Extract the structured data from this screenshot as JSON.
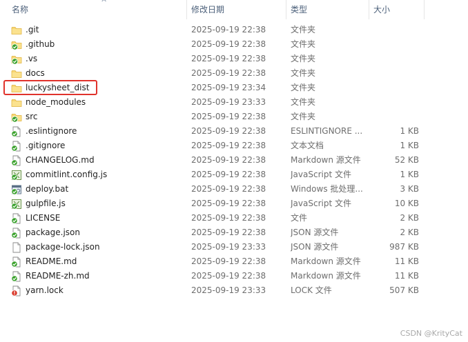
{
  "columns": {
    "name": "名称",
    "date": "修改日期",
    "type": "类型",
    "size": "大小"
  },
  "sort_indicator": "^",
  "files": [
    {
      "name": ".git",
      "date": "2025-09-19 22:38",
      "type": "文件夹",
      "size": "",
      "icon": "folder-icon"
    },
    {
      "name": ".github",
      "date": "2025-09-19 22:38",
      "type": "文件夹",
      "size": "",
      "icon": "folder-synced-icon"
    },
    {
      "name": ".vs",
      "date": "2025-09-19 22:38",
      "type": "文件夹",
      "size": "",
      "icon": "folder-synced-icon"
    },
    {
      "name": "docs",
      "date": "2025-09-19 22:38",
      "type": "文件夹",
      "size": "",
      "icon": "folder-icon"
    },
    {
      "name": "luckysheet_dist",
      "date": "2025-09-19 23:34",
      "type": "文件夹",
      "size": "",
      "icon": "folder-icon"
    },
    {
      "name": "node_modules",
      "date": "2025-09-19 23:33",
      "type": "文件夹",
      "size": "",
      "icon": "folder-icon"
    },
    {
      "name": "src",
      "date": "2025-09-19 22:38",
      "type": "文件夹",
      "size": "",
      "icon": "folder-synced-icon"
    },
    {
      "name": ".eslintignore",
      "date": "2025-09-19 22:38",
      "type": "ESLINTIGNORE ...",
      "size": "1 KB",
      "icon": "file-synced-icon"
    },
    {
      "name": ".gitignore",
      "date": "2025-09-19 22:38",
      "type": "文本文档",
      "size": "1 KB",
      "icon": "file-synced-icon"
    },
    {
      "name": "CHANGELOG.md",
      "date": "2025-09-19 22:38",
      "type": "Markdown 源文件",
      "size": "52 KB",
      "icon": "file-synced-icon"
    },
    {
      "name": "commitlint.config.js",
      "date": "2025-09-19 22:38",
      "type": "JavaScript 文件",
      "size": "1 KB",
      "icon": "script-synced-icon"
    },
    {
      "name": "deploy.bat",
      "date": "2025-09-19 22:38",
      "type": "Windows 批处理...",
      "size": "3 KB",
      "icon": "batch-synced-icon"
    },
    {
      "name": "gulpfile.js",
      "date": "2025-09-19 22:38",
      "type": "JavaScript 文件",
      "size": "10 KB",
      "icon": "script-synced-icon"
    },
    {
      "name": "LICENSE",
      "date": "2025-09-19 22:38",
      "type": "文件",
      "size": "2 KB",
      "icon": "file-synced-icon"
    },
    {
      "name": "package.json",
      "date": "2025-09-19 22:38",
      "type": "JSON 源文件",
      "size": "2 KB",
      "icon": "file-synced-icon"
    },
    {
      "name": "package-lock.json",
      "date": "2025-09-19 23:33",
      "type": "JSON 源文件",
      "size": "987 KB",
      "icon": "file-icon"
    },
    {
      "name": "README.md",
      "date": "2025-09-19 22:38",
      "type": "Markdown 源文件",
      "size": "11 KB",
      "icon": "file-synced-icon"
    },
    {
      "name": "README-zh.md",
      "date": "2025-09-19 22:38",
      "type": "Markdown 源文件",
      "size": "11 KB",
      "icon": "file-synced-icon"
    },
    {
      "name": "yarn.lock",
      "date": "2025-09-19 23:33",
      "type": "LOCK 文件",
      "size": "507 KB",
      "icon": "file-error-icon"
    }
  ],
  "highlighted_item": "luckysheet_dist",
  "watermark": "CSDN @KrityCat",
  "colors": {
    "highlight_border": "#e0322b",
    "folder": "#f0c04a",
    "sync_badge": "#3aa12c",
    "error_badge": "#d93a2b"
  }
}
